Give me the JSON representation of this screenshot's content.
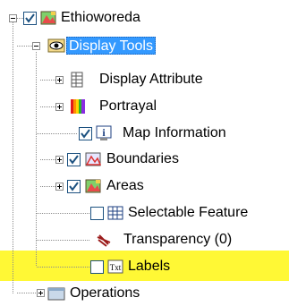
{
  "tree": {
    "root_label": "Ethioworeda",
    "display_tools_label": "Display Tools",
    "items": [
      {
        "label": "Display Attribute",
        "checked": null
      },
      {
        "label": "Portrayal",
        "checked": null
      },
      {
        "label": "Map Information",
        "checked": true
      },
      {
        "label": "Boundaries",
        "checked": true
      },
      {
        "label": "Areas",
        "checked": true
      },
      {
        "label": "Selectable Feature",
        "checked": false
      },
      {
        "label": "Transparency (0)",
        "checked": null
      },
      {
        "label": "Labels",
        "checked": false
      }
    ],
    "operations_label": "Operations"
  },
  "colors": {
    "selection": "#3399ff",
    "highlight": "#fff835",
    "check": "#1c5180"
  },
  "icons": {
    "root": "layer-map-icon",
    "display_tools": "eye-icon",
    "display_attribute": "table-icon",
    "portrayal": "color-bars-icon",
    "map_information": "info-icon",
    "boundaries": "boundary-map-icon",
    "areas": "area-map-icon",
    "selectable_feature": "grid-select-icon",
    "transparency": "transparency-icon",
    "labels": "text-label-icon",
    "operations": "operations-folder-icon"
  }
}
